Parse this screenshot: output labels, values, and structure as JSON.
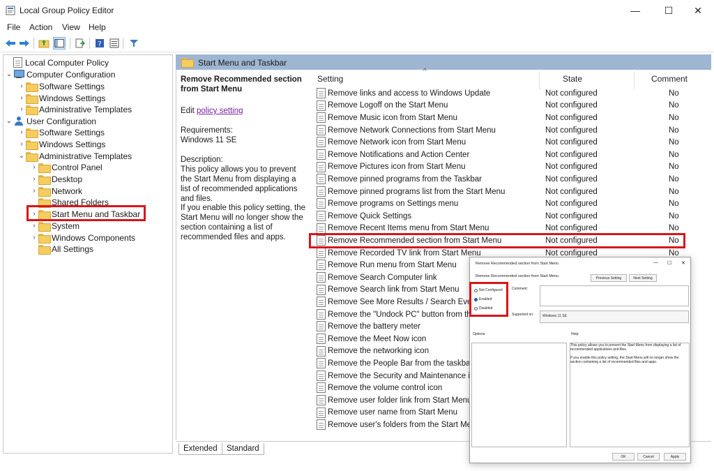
{
  "window": {
    "title": "Local Group Policy Editor",
    "minimize": "—",
    "maximize": "☐",
    "close": "✕"
  },
  "menu": [
    "File",
    "Action",
    "View",
    "Help"
  ],
  "toolbar": {
    "icons": [
      "back-arrow-icon",
      "forward-arrow-icon",
      "up-folder-icon",
      "show-hide-tree-icon",
      "export-icon",
      "help-icon",
      "properties-icon",
      "filter-icon"
    ]
  },
  "tree": [
    {
      "label": "Local Computer Policy",
      "level": 0,
      "icon": "doc-icon",
      "exp": ""
    },
    {
      "label": "Computer Configuration",
      "level": 1,
      "icon": "pc-icon",
      "exp": "⌄"
    },
    {
      "label": "Software Settings",
      "level": 2,
      "icon": "folder-icon",
      "exp": "›"
    },
    {
      "label": "Windows Settings",
      "level": 2,
      "icon": "folder-icon",
      "exp": "›"
    },
    {
      "label": "Administrative Templates",
      "level": 2,
      "icon": "folder-icon",
      "exp": "›"
    },
    {
      "label": "User Configuration",
      "level": 1,
      "icon": "user-icon",
      "exp": "⌄"
    },
    {
      "label": "Software Settings",
      "level": 2,
      "icon": "folder-icon",
      "exp": "›"
    },
    {
      "label": "Windows Settings",
      "level": 2,
      "icon": "folder-icon",
      "exp": "›"
    },
    {
      "label": "Administrative Templates",
      "level": 2,
      "icon": "folder-icon",
      "exp": "⌄"
    },
    {
      "label": "Control Panel",
      "level": 3,
      "icon": "folder-icon",
      "exp": "›"
    },
    {
      "label": "Desktop",
      "level": 3,
      "icon": "folder-icon",
      "exp": "›"
    },
    {
      "label": "Network",
      "level": 3,
      "icon": "folder-icon",
      "exp": "›"
    },
    {
      "label": "Shared Folders",
      "level": 3,
      "icon": "folder-icon",
      "exp": ""
    },
    {
      "label": "Start Menu and Taskbar",
      "level": 3,
      "icon": "folder-icon",
      "exp": "›"
    },
    {
      "label": "System",
      "level": 3,
      "icon": "folder-icon",
      "exp": "›"
    },
    {
      "label": "Windows Components",
      "level": 3,
      "icon": "folder-icon",
      "exp": "›"
    },
    {
      "label": "All Settings",
      "level": 3,
      "icon": "folder-icon",
      "exp": ""
    }
  ],
  "header": {
    "title": "Start Menu and Taskbar"
  },
  "description": {
    "title": "Remove Recommended section from Start Menu",
    "edit_prefix": "Edit ",
    "edit_link": "policy setting",
    "requirements_label": "Requirements:",
    "requirements_value": "Windows 11 SE",
    "description_label": "Description:",
    "description_text": "This policy allows you to prevent the Start Menu from displaying a list of recommended applications and files.",
    "enable_text": "If you enable this policy setting, the Start Menu will no longer show the section containing a list of recommended files and apps."
  },
  "columns": {
    "setting": "Setting",
    "state": "State",
    "comment": "Comment"
  },
  "rows": [
    {
      "name": "Remove links and access to Windows Update",
      "state": "Not configured",
      "comment": "No"
    },
    {
      "name": "Remove Logoff on the Start Menu",
      "state": "Not configured",
      "comment": "No"
    },
    {
      "name": "Remove Music icon from Start Menu",
      "state": "Not configured",
      "comment": "No"
    },
    {
      "name": "Remove Network Connections from Start Menu",
      "state": "Not configured",
      "comment": "No"
    },
    {
      "name": "Remove Network icon from Start Menu",
      "state": "Not configured",
      "comment": "No"
    },
    {
      "name": "Remove Notifications and Action Center",
      "state": "Not configured",
      "comment": "No"
    },
    {
      "name": "Remove Pictures icon from Start Menu",
      "state": "Not configured",
      "comment": "No"
    },
    {
      "name": "Remove pinned programs from the Taskbar",
      "state": "Not configured",
      "comment": "No"
    },
    {
      "name": "Remove pinned programs list from the Start Menu",
      "state": "Not configured",
      "comment": "No"
    },
    {
      "name": "Remove programs on Settings menu",
      "state": "Not configured",
      "comment": "No"
    },
    {
      "name": "Remove Quick Settings",
      "state": "Not configured",
      "comment": "No"
    },
    {
      "name": "Remove Recent Items menu from Start Menu",
      "state": "Not configured",
      "comment": "No"
    },
    {
      "name": "Remove Recommended section from Start Menu",
      "state": "Not configured",
      "comment": "No"
    },
    {
      "name": "Remove Recorded TV link from Start Menu",
      "state": "Not configured",
      "comment": "No"
    },
    {
      "name": "Remove Run menu from Start Menu",
      "state": "",
      "comment": ""
    },
    {
      "name": "Remove Search Computer link",
      "state": "",
      "comment": ""
    },
    {
      "name": "Remove Search link from Start Menu",
      "state": "",
      "comment": ""
    },
    {
      "name": "Remove See More Results / Search Everyw",
      "state": "",
      "comment": ""
    },
    {
      "name": "Remove the \"Undock PC\" button from th",
      "state": "",
      "comment": ""
    },
    {
      "name": "Remove the battery meter",
      "state": "",
      "comment": ""
    },
    {
      "name": "Remove the Meet Now icon",
      "state": "",
      "comment": ""
    },
    {
      "name": "Remove the networking icon",
      "state": "",
      "comment": ""
    },
    {
      "name": "Remove the People Bar from the taskbar",
      "state": "",
      "comment": ""
    },
    {
      "name": "Remove the Security and Maintenance ico",
      "state": "",
      "comment": ""
    },
    {
      "name": "Remove the volume control icon",
      "state": "",
      "comment": ""
    },
    {
      "name": "Remove user folder link from Start Menu",
      "state": "",
      "comment": ""
    },
    {
      "name": "Remove user name from Start Menu",
      "state": "",
      "comment": ""
    },
    {
      "name": "Remove user's folders from the Start Men",
      "state": "",
      "comment": ""
    }
  ],
  "tabs": [
    "Extended",
    "Standard"
  ],
  "dialog": {
    "title": "Remove Recommended section from Start Menu",
    "subtitle": "Remove Recommended section from Start Menu",
    "prev_button": "Previous Setting",
    "next_button": "Next Setting",
    "options": [
      "Not Configured",
      "Enabled",
      "Disabled"
    ],
    "selected": "Enabled",
    "comment_label": "Comment:",
    "supported_label": "Supported on:",
    "supported_value": "Windows 11 SE",
    "options_label": "Options:",
    "help_label": "Help:",
    "help_text_1": "This policy allows you to prevent the Start Menu from displaying a list of recommended applications and files.",
    "help_text_2": "If you enable this policy setting, the Start Menu will no longer show the section containing a list of recommended files and apps.",
    "ok": "OK",
    "cancel": "Cancel",
    "apply": "Apply"
  },
  "colors": {
    "highlight": "#d9141b",
    "header_bg": "#9fb6d3",
    "link": "#7a1fa2"
  }
}
